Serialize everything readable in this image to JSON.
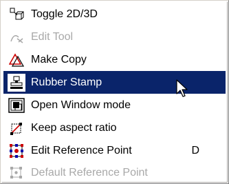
{
  "menu": {
    "items": [
      {
        "label": "Toggle 2D/3D",
        "icon": "toggle-2d3d-icon",
        "enabled": true
      },
      {
        "label": "Edit Tool",
        "icon": "edit-tool-icon",
        "enabled": false
      },
      {
        "label": "Make Copy",
        "icon": "make-copy-icon",
        "enabled": true
      },
      {
        "label": "Rubber Stamp",
        "icon": "rubber-stamp-icon",
        "enabled": true,
        "highlighted": true
      },
      {
        "label": "Open Window mode",
        "icon": "open-window-icon",
        "enabled": true
      },
      {
        "label": "Keep aspect ratio",
        "icon": "keep-aspect-ratio-icon",
        "enabled": true
      },
      {
        "label": "Edit Reference Point",
        "icon": "edit-reference-point-icon",
        "enabled": true,
        "shortcut": "D"
      },
      {
        "label": "Default Reference Point",
        "icon": "default-reference-point-icon",
        "enabled": false
      }
    ]
  },
  "colors": {
    "highlight": "#0a246a",
    "highlight_text": "#ffffff",
    "disabled_text": "#a8a8a8",
    "accent_red": "#cc0000"
  }
}
